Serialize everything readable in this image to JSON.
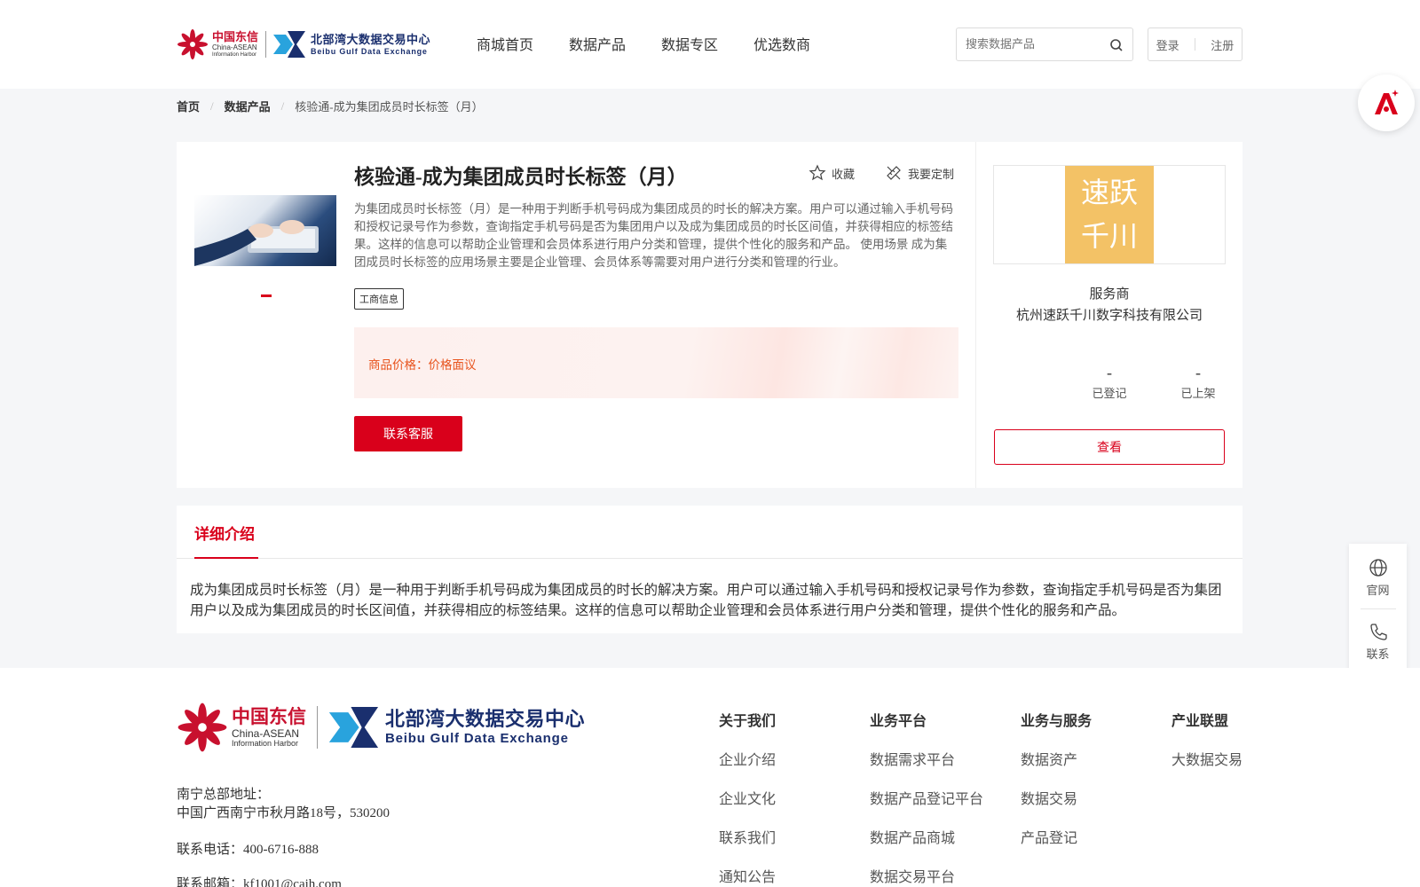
{
  "header": {
    "logo_cn": {
      "line1": "中国东信",
      "line2": "China-ASEAN",
      "line3": "Information Harbor"
    },
    "logo_bg": {
      "line1": "北部湾大数据交易中心",
      "line2": "Beibu Gulf Data Exchange"
    },
    "nav": [
      "商城首页",
      "数据产品",
      "数据专区",
      "优选数商"
    ],
    "search_placeholder": "搜索数据产品",
    "login": "登录",
    "register": "注册"
  },
  "breadcrumb": {
    "home": "首页",
    "category": "数据产品",
    "current": "核验通-成为集团成员时长标签（月）"
  },
  "product": {
    "title": "核验通-成为集团成员时长标签（月）",
    "favorite": "收藏",
    "customize": "我要定制",
    "description": "为集团成员时长标签（月）是一种用于判断手机号码成为集团成员的时长的解决方案。用户可以通过输入手机号码和授权记录号作为参数，查询指定手机号码是否为集团用户以及成为集团成员的时长区间值，并获得相应的标签结果。这样的信息可以帮助企业管理和会员体系进行用户分类和管理，提供个性化的服务和产品。 使用场景 成为集团成员时长标签的应用场景主要是企业管理、会员体系等需要对用户进行分类和管理的行业。",
    "tag": "工商信息",
    "price_label": "商品价格：",
    "price_value": "价格面议",
    "contact_button": "联系客服"
  },
  "provider": {
    "logo_text_1": "速跃",
    "logo_text_2": "千川",
    "role": "服务商",
    "name": "杭州速跃千川数字科技有限公司",
    "registered_value": "-",
    "registered_label": "已登记",
    "listed_value": "-",
    "listed_label": "已上架",
    "view_button": "查看"
  },
  "detail": {
    "tab": "详细介绍",
    "text": "成为集团成员时长标签（月）是一种用于判断手机号码成为集团成员的时长的解决方案。用户可以通过输入手机号码和授权记录号作为参数，查询指定手机号码是否为集团用户以及成为集团成员的时长区间值，并获得相应的标签结果。这样的信息可以帮助企业管理和会员体系进行用户分类和管理，提供个性化的服务和产品。"
  },
  "side_tools": {
    "website": "官网",
    "contact": "联系"
  },
  "footer": {
    "address_label": "南宁总部地址：",
    "address": "中国广西南宁市秋月路18号，530200",
    "phone": "联系电话：400-6716-888",
    "email": "联系邮箱：kf1001@caih.com",
    "columns": [
      {
        "title": "关于我们",
        "items": [
          "企业介绍",
          "企业文化",
          "联系我们",
          "通知公告"
        ]
      },
      {
        "title": "业务平台",
        "items": [
          "数据需求平台",
          "数据产品登记平台",
          "数据产品商城",
          "数据交易平台"
        ]
      },
      {
        "title": "业务与服务",
        "items": [
          "数据资产",
          "数据交易",
          "产品登记"
        ]
      },
      {
        "title": "产业联盟",
        "items": [
          "大数据交易"
        ]
      }
    ]
  },
  "colors": {
    "brand_red": "#d9001b",
    "price_orange": "#e8541e",
    "provider_logo_bg": "#f3c266",
    "bg_navy": "#1a2f6e"
  }
}
